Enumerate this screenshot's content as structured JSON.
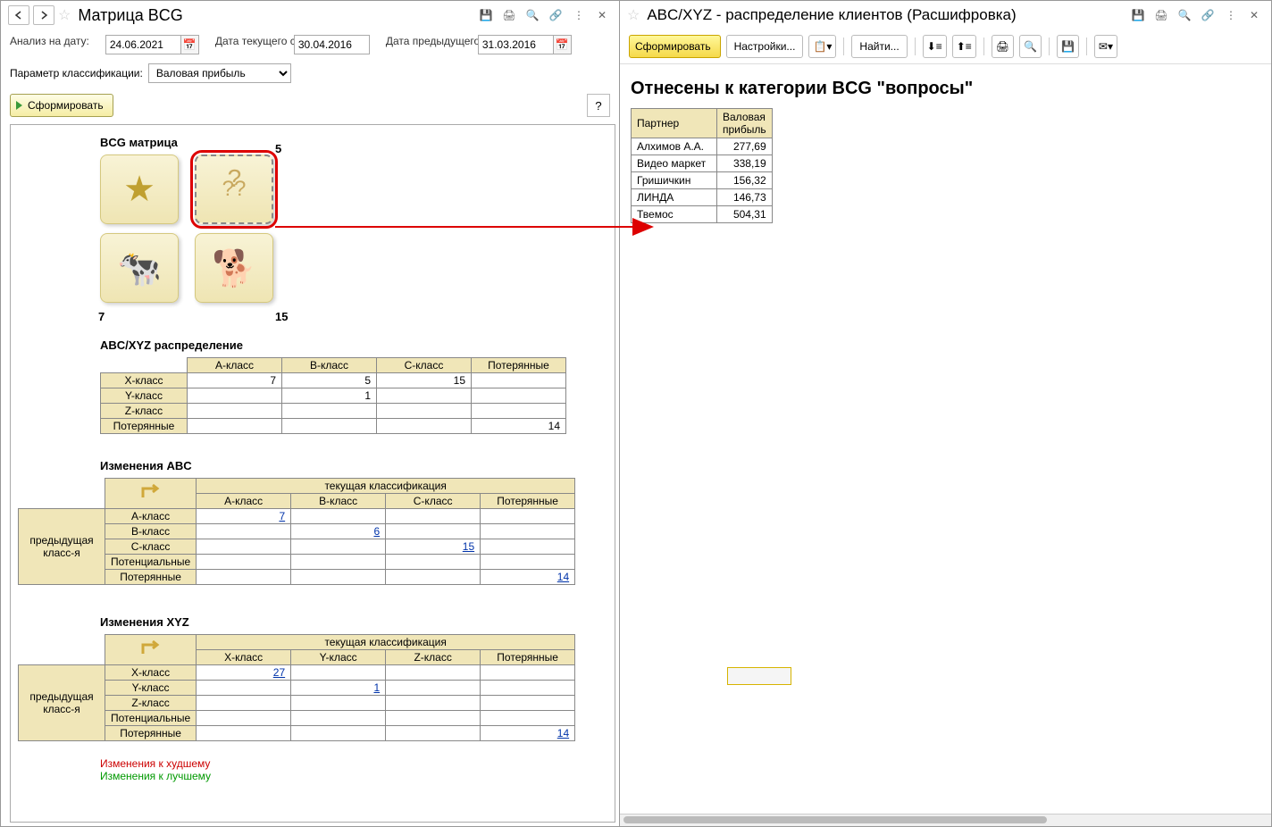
{
  "left": {
    "title": "Матрица BCG",
    "params": {
      "analysis_label": "Анализ на дату:",
      "analysis_date": "24.06.2021",
      "current_label": "Дата текущего среза:",
      "current_date": "30.04.2016",
      "prev_label": "Дата предыдущего среза:",
      "prev_date": "31.03.2016"
    },
    "classif_label": "Параметр классификации:",
    "classif_value": "Валовая прибыль",
    "generate_label": "Сформировать",
    "help_label": "?",
    "bcg": {
      "title": "BCG матрица",
      "num_tr": "5",
      "num_bl": "7",
      "num_br": "15"
    },
    "abcxyz": {
      "title": "ABC/XYZ распределение",
      "cols": [
        "А-класс",
        "В-класс",
        "С-класс",
        "Потерянные"
      ],
      "rows": [
        {
          "label": "X-класс",
          "vals": [
            "7",
            "5",
            "15",
            ""
          ]
        },
        {
          "label": "Y-класс",
          "vals": [
            "",
            "1",
            "",
            ""
          ]
        },
        {
          "label": "Z-класс",
          "vals": [
            "",
            "",
            "",
            ""
          ]
        },
        {
          "label": "Потерянные",
          "vals": [
            "",
            "",
            "",
            "14"
          ]
        }
      ]
    },
    "abc": {
      "title": "Изменения ABC",
      "side_label": "предыдущая класс-я",
      "top_label": "текущая классификация",
      "cols": [
        "А-класс",
        "В-класс",
        "С-класс",
        "Потерянные"
      ],
      "rows": [
        {
          "label": "А-класс",
          "vals": [
            "7",
            "",
            "",
            ""
          ],
          "link": [
            true,
            false,
            false,
            false
          ]
        },
        {
          "label": "В-класс",
          "vals": [
            "",
            "6",
            "",
            ""
          ],
          "link": [
            false,
            true,
            false,
            false
          ]
        },
        {
          "label": "С-класс",
          "vals": [
            "",
            "",
            "15",
            ""
          ],
          "link": [
            false,
            false,
            true,
            false
          ]
        },
        {
          "label": "Потенциальные",
          "vals": [
            "",
            "",
            "",
            ""
          ],
          "link": [
            false,
            false,
            false,
            false
          ]
        },
        {
          "label": "Потерянные",
          "vals": [
            "",
            "",
            "",
            "14"
          ],
          "link": [
            false,
            false,
            false,
            true
          ]
        }
      ]
    },
    "xyz": {
      "title": "Изменения XYZ",
      "side_label": "предыдущая класс-я",
      "top_label": "текущая классификация",
      "cols": [
        "X-класс",
        "Y-класс",
        "Z-класс",
        "Потерянные"
      ],
      "rows": [
        {
          "label": "X-класс",
          "vals": [
            "27",
            "",
            "",
            ""
          ],
          "link": [
            true,
            false,
            false,
            false
          ]
        },
        {
          "label": "Y-класс",
          "vals": [
            "",
            "1",
            "",
            ""
          ],
          "link": [
            false,
            true,
            false,
            false
          ]
        },
        {
          "label": "Z-класс",
          "vals": [
            "",
            "",
            "",
            ""
          ],
          "link": [
            false,
            false,
            false,
            false
          ]
        },
        {
          "label": "Потенциальные",
          "vals": [
            "",
            "",
            "",
            ""
          ],
          "link": [
            false,
            false,
            false,
            false
          ]
        },
        {
          "label": "Потерянные",
          "vals": [
            "",
            "",
            "",
            "14"
          ],
          "link": [
            false,
            false,
            false,
            true
          ]
        }
      ]
    },
    "legend": {
      "bad": "Изменения к худшему",
      "good": "Изменения к лучшему"
    }
  },
  "right": {
    "title": "ABC/XYZ - распределение клиентов (Расшифровка)",
    "generate_label": "Сформировать",
    "settings_label": "Настройки...",
    "find_label": "Найти...",
    "heading": "Отнесены к категории BCG \"вопросы\"",
    "table": {
      "cols": [
        "Партнер",
        "Валовая прибыль"
      ],
      "rows": [
        [
          "Алхимов А.А.",
          "277,69"
        ],
        [
          "Видео маркет",
          "338,19"
        ],
        [
          "Гришичкин",
          "156,32"
        ],
        [
          "ЛИНДА",
          "146,73"
        ],
        [
          "Твемос",
          "504,31"
        ]
      ]
    }
  }
}
